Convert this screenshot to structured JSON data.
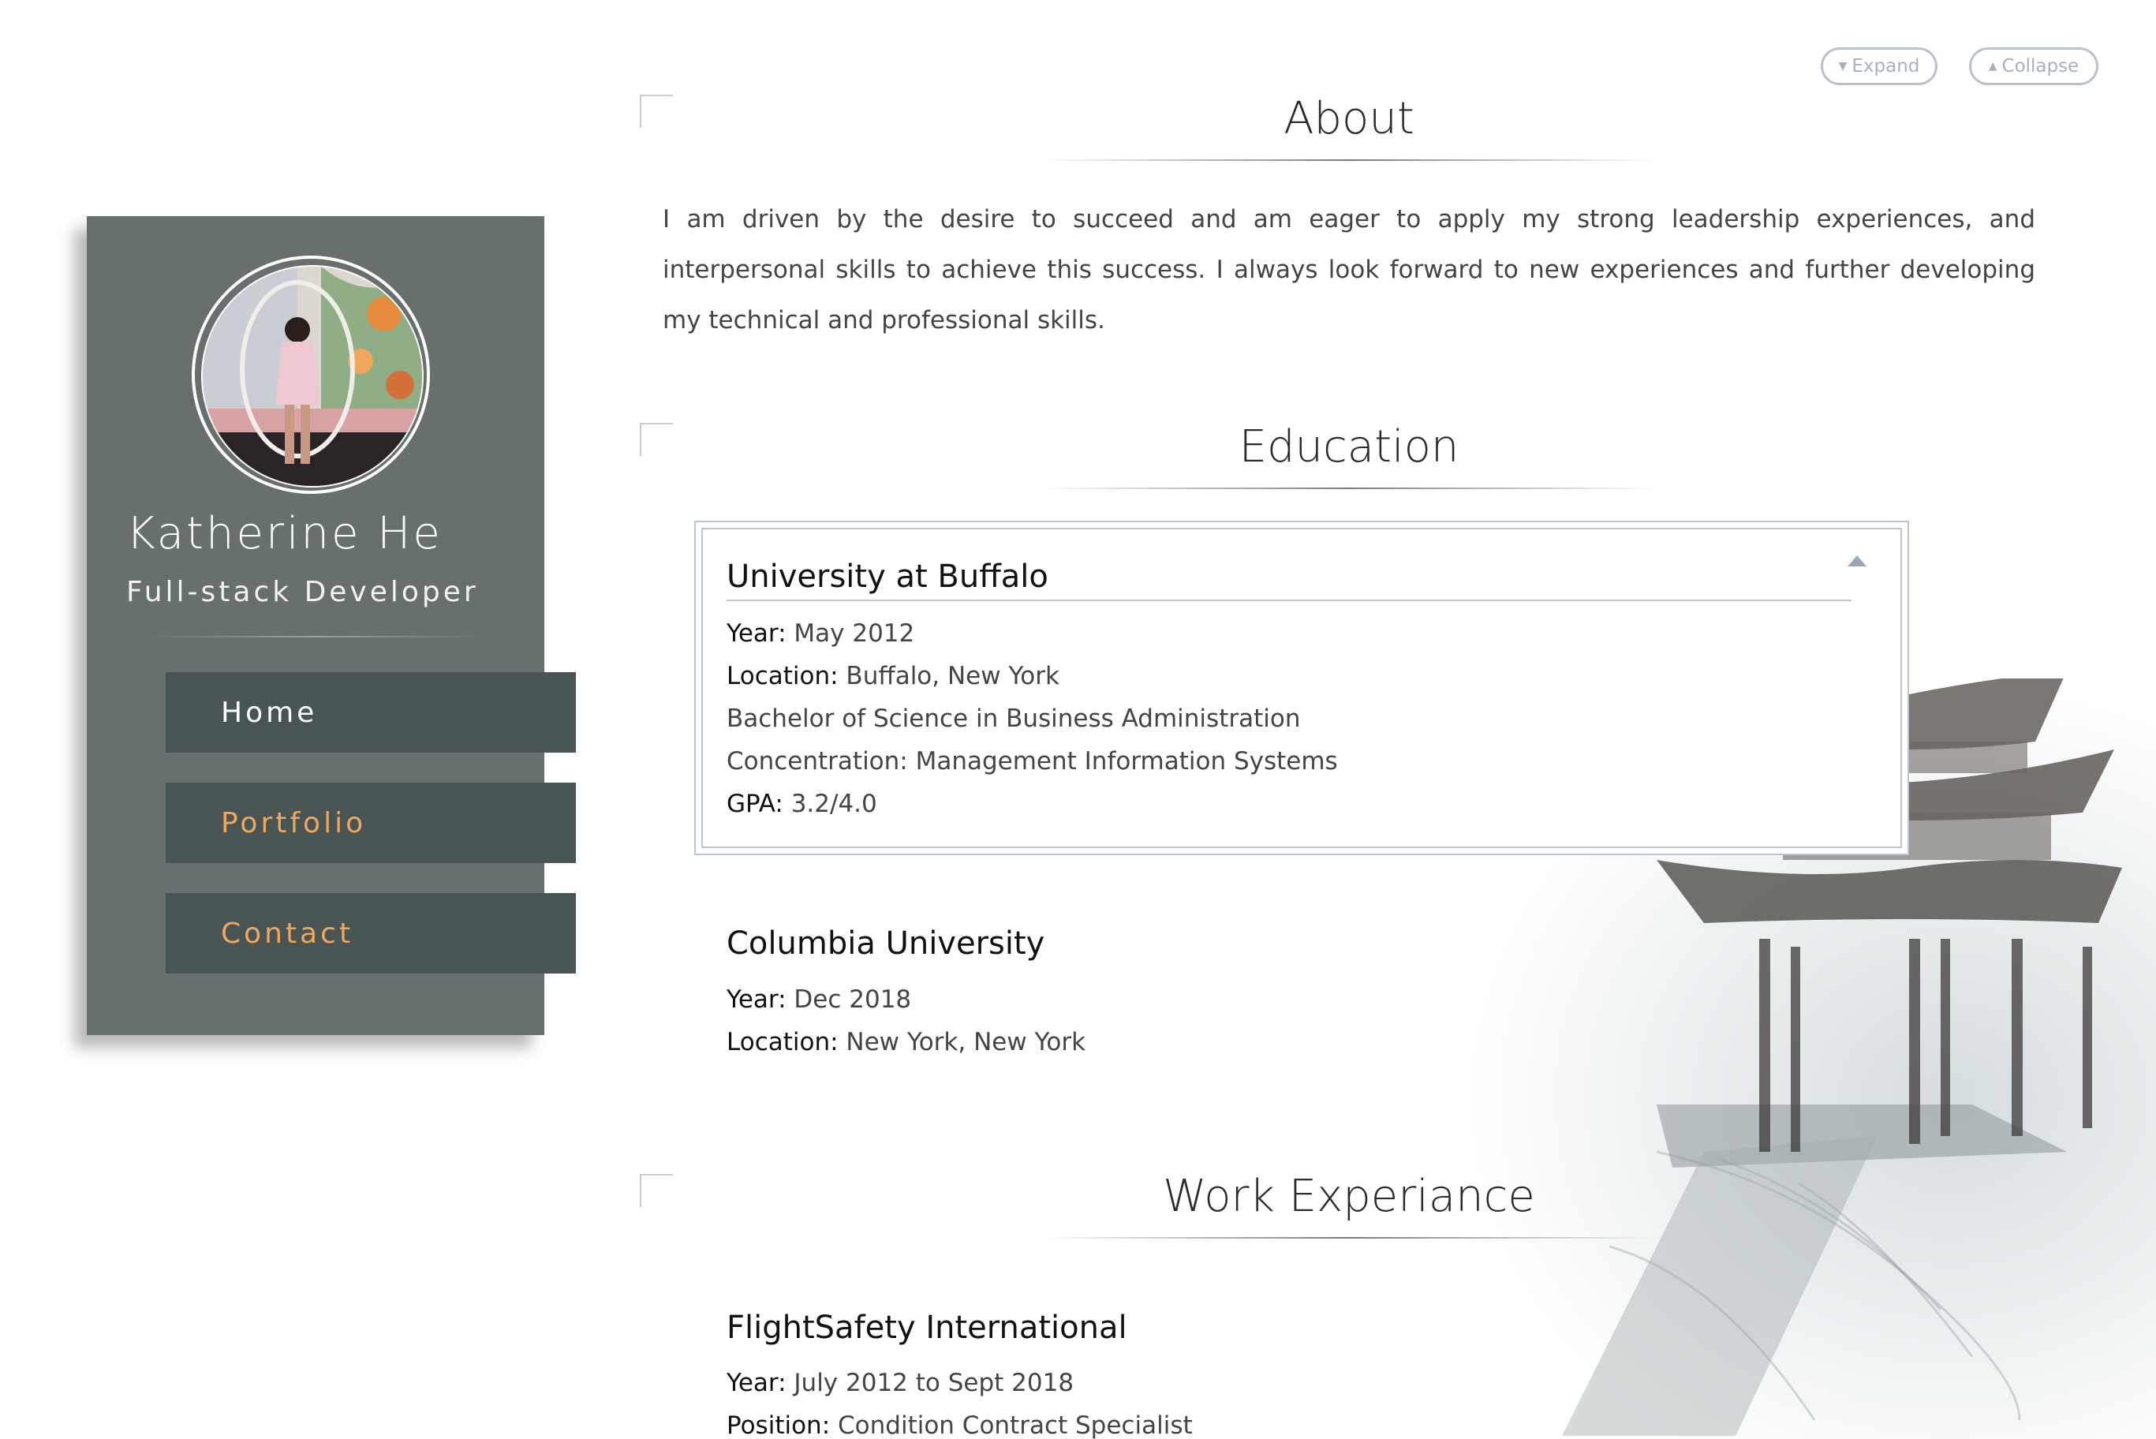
{
  "profile": {
    "name": "Katherine He",
    "title": "Full-stack Developer"
  },
  "nav": {
    "home": "Home",
    "portfolio": "Portfolio",
    "contact": "Contact"
  },
  "controls": {
    "expand": "Expand",
    "collapse": "Collapse"
  },
  "about": {
    "title": "About",
    "text": "I am driven by the desire to succeed and am eager to apply my strong leadership experiences, and interpersonal skills to achieve this success. I always look forward to new experiences and further developing my technical and professional skills."
  },
  "education": {
    "title": "Education",
    "schools": [
      {
        "name": "University at Buffalo",
        "year_label": "Year:",
        "year": "May 2012",
        "location_label": "Location:",
        "location": "Buffalo, New York",
        "degree": "Bachelor of Science in Business Administration",
        "concentration": "Concentration: Management Information Systems",
        "gpa_label": "GPA:",
        "gpa": "3.2/4.0"
      },
      {
        "name": "Columbia University",
        "year_label": "Year:",
        "year": "Dec 2018",
        "location_label": "Location:",
        "location": "New York, New York"
      }
    ]
  },
  "work": {
    "title": "Work Experiance",
    "jobs": [
      {
        "company": "FlightSafety International",
        "year_label": "Year:",
        "year": "July 2012 to Sept 2018",
        "position_label": "Position:",
        "position": "Condition Contract Specialist"
      }
    ]
  },
  "colors": {
    "sidebar": "#676f6f",
    "nav_bg": "#495455",
    "nav_accent": "#eda85e"
  }
}
